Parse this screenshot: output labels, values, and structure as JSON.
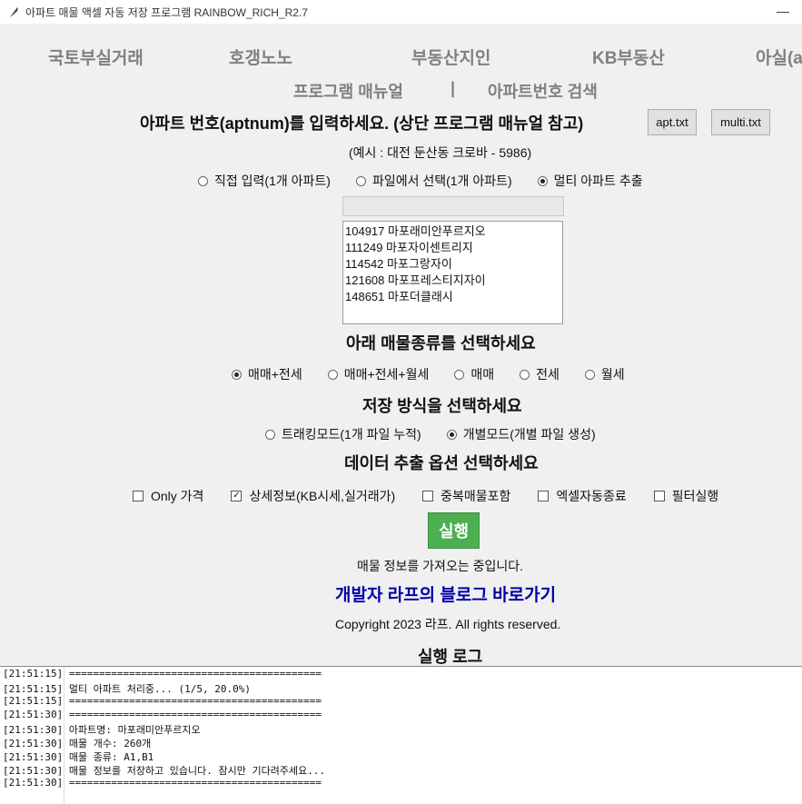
{
  "window": {
    "title": "아파트 매물 액셀 자동 저장 프로그램 RAINBOW_RICH_R2.7",
    "minimize": "—"
  },
  "nav": {
    "row1": [
      "국토부실거래",
      "호갱노노",
      "부동산지인",
      "KB부동산",
      "아실(a"
    ],
    "row2": [
      "프로그램 매뉴얼",
      "|",
      "아파트번호 검색"
    ]
  },
  "input_section": {
    "heading": "아파트 번호(aptnum)를 입력하세요. (상단 프로그램 매뉴얼 참고)",
    "apt_button": "apt.txt",
    "multi_button": "multi.txt",
    "example": "(예시 : 대전 둔산동 크로바 - 5986)",
    "modes": [
      {
        "label": "직접 입력(1개 아파트)",
        "selected": false
      },
      {
        "label": "파일에서 선택(1개 아파트)",
        "selected": false
      },
      {
        "label": "멀티 아파트 추출",
        "selected": true
      }
    ],
    "entry_value": "",
    "list_items": [
      "104917 마포래미안푸르지오",
      "111249 마포자이센트리지",
      "114542 마포그랑자이",
      "121608 마포프레스티지자이",
      "148651 마포더클래시"
    ]
  },
  "type_section": {
    "heading": "아래 매물종류를 선택하세요",
    "options": [
      {
        "label": "매매+전세",
        "selected": true
      },
      {
        "label": "매매+전세+월세",
        "selected": false
      },
      {
        "label": "매매",
        "selected": false
      },
      {
        "label": "전세",
        "selected": false
      },
      {
        "label": "월세",
        "selected": false
      }
    ]
  },
  "save_section": {
    "heading": "저장 방식을 선택하세요",
    "options": [
      {
        "label": "트래킹모드(1개 파일 누적)",
        "selected": false
      },
      {
        "label": "개별모드(개별 파일 생성)",
        "selected": true
      }
    ]
  },
  "extract_section": {
    "heading": "데이터 추출 옵션 선택하세요",
    "options": [
      {
        "label": "Only 가격",
        "checked": false
      },
      {
        "label": "상세정보(KB시세,실거래가)",
        "checked": true
      },
      {
        "label": "중복매물포함",
        "checked": false
      },
      {
        "label": "엑셀자동종료",
        "checked": false
      },
      {
        "label": "필터실행",
        "checked": false
      }
    ]
  },
  "run_button": "실행",
  "status": "매물 정보를 가져오는 중입니다.",
  "blog_link": "개발자 라프의 블로그 바로가기",
  "copyright": "Copyright 2023 라프. All rights reserved.",
  "log": {
    "heading": "실행 로그",
    "lines": [
      "[21:51:15] ==========================================",
      "[21:51:15] 멀티 아파트 처리중... (1/5, 20.0%)",
      "[21:51:15] ==========================================",
      "[21:51:30] ==========================================",
      "[21:51:30] 아파트명: 마포래미안푸르지오",
      "[21:51:30] 매물 개수: 260개",
      "[21:51:30] 매물 종류: A1,B1",
      "[21:51:30] 매물 정보를 저장하고 있습니다. 잠시만 기다려주세요...",
      "[21:51:30] =========================================="
    ]
  }
}
